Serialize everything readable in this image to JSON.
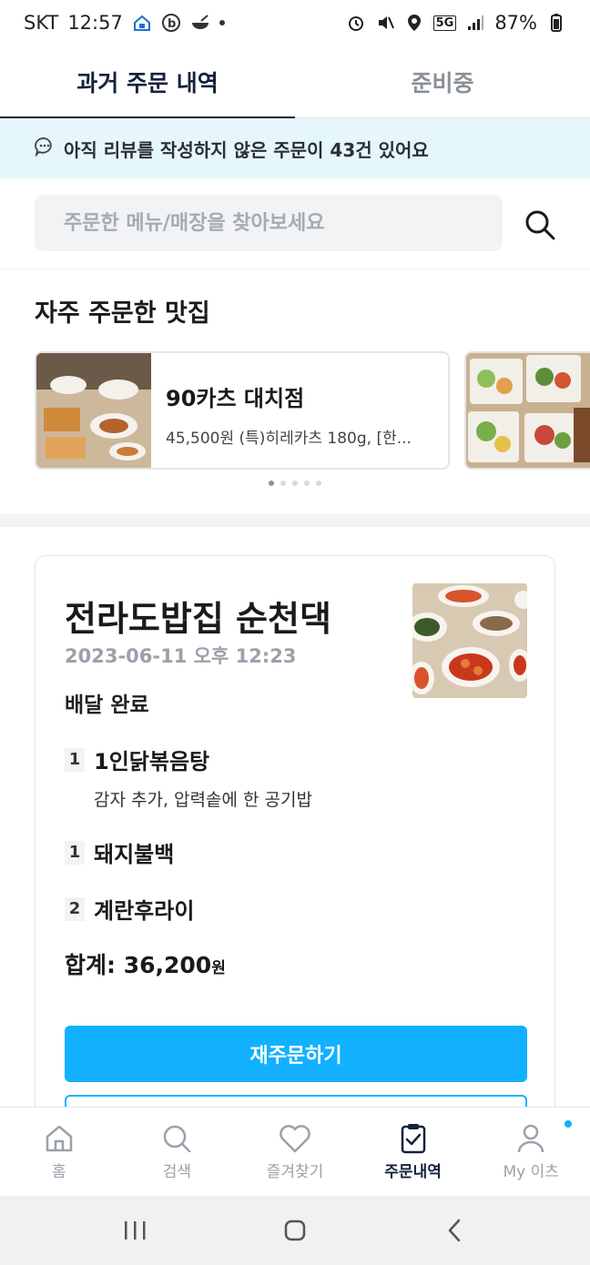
{
  "status_bar": {
    "carrier": "SKT",
    "time": "12:57",
    "network": "5G",
    "battery": "87%"
  },
  "tabs": [
    {
      "label": "과거 주문 내역",
      "active": true
    },
    {
      "label": "준비중",
      "active": false
    }
  ],
  "review_banner": {
    "text": "아직 리뷰를 작성하지 않은 주문이 43건 있어요"
  },
  "search": {
    "placeholder": "주문한 메뉴/매장을 찾아보세요"
  },
  "frequent": {
    "title": "자주 주문한 맛집",
    "cards": [
      {
        "name": "90카츠 대치점",
        "desc": "45,500원 (특)히레카츠 180g, [한..."
      }
    ],
    "page_count": 5,
    "active_page": 1
  },
  "order": {
    "store_name": "전라도밥집 순천댁",
    "date": "2023-06-11 오후 12:23",
    "status": "배달 완료",
    "items": [
      {
        "qty": "1",
        "name": "1인닭볶음탕",
        "option": "감자 추가, 압력솥에 한 공기밥"
      },
      {
        "qty": "1",
        "name": "돼지불백",
        "option": ""
      },
      {
        "qty": "2",
        "name": "계란후라이",
        "option": ""
      }
    ],
    "total_label": "합계: 36,200",
    "total_unit": "원",
    "reorder_label": "재주문하기"
  },
  "bottom_nav": [
    {
      "label": "홈",
      "icon": "home-icon",
      "active": false
    },
    {
      "label": "검색",
      "icon": "search-icon",
      "active": false
    },
    {
      "label": "즐겨찾기",
      "icon": "heart-icon",
      "active": false
    },
    {
      "label": "주문내역",
      "icon": "clipboard-check-icon",
      "active": true
    },
    {
      "label": "My 이츠",
      "icon": "person-icon",
      "active": false
    }
  ],
  "colors": {
    "accent": "#12b0ff",
    "navy": "#14213d",
    "banner_bg": "#e6f6fd"
  }
}
